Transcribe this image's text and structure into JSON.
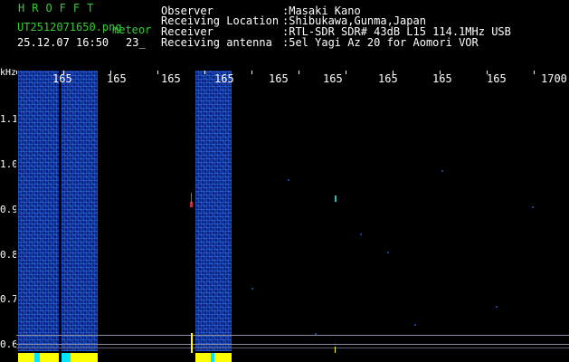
{
  "header": {
    "logo": "HROFFT",
    "filename": "UT2512071650.png",
    "filename_suffix": "meteor",
    "datetime": "25.12.07 16:50",
    "count": "23_"
  },
  "info": {
    "observer_label": "Observer",
    "observer_value": ":Masaki Kano",
    "location_label": "Receiving Location",
    "location_value": ":Shibukawa,Gunma,Japan",
    "receiver_label": "Receiver",
    "receiver_value": ":RTL-SDR SDR# 43dB L15 114.1MHz USB",
    "antenna_label": "Receiving antenna",
    "antenna_value": ":5el Yagi Az 20 for Aomori VOR"
  },
  "axis": {
    "unit": "kHz",
    "y_ticks": [
      "1.1",
      "1.0",
      "0.9",
      "0.8",
      "0.7",
      "0.6"
    ],
    "x_ticks": [
      "165",
      "165",
      "165",
      "165",
      "165",
      "165",
      "165",
      "165",
      "165",
      "1700"
    ]
  },
  "colors": {
    "text_green": "#33cc33",
    "text_white": "#ffffff",
    "band_blue": "#0d1f7a",
    "strip_yellow": "#ffff00",
    "strip_cyan": "#00e5ff"
  }
}
